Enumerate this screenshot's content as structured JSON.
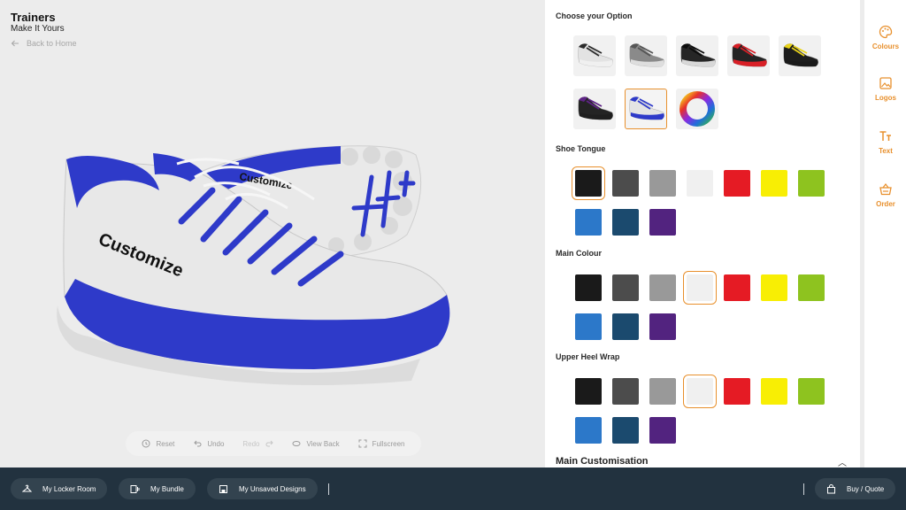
{
  "header": {
    "title": "Trainers",
    "subtitle": "Make It Yours",
    "back_label": "Back to Home"
  },
  "viewer": {
    "shoe_text": "Customize",
    "tongue_text": "Customize",
    "toolbar": {
      "reset": "Reset",
      "undo": "Undo",
      "redo": "Redo",
      "view_back": "View Back",
      "fullscreen": "Fullscreen"
    }
  },
  "panel": {
    "choose_title": "Choose your Option",
    "options": [
      {
        "name": "white-black",
        "upper": "#e3e3e3",
        "accent": "#2a2a2a",
        "sole": "#f0f0f0"
      },
      {
        "name": "grey",
        "upper": "#8a8a8a",
        "accent": "#555555",
        "sole": "#dedede"
      },
      {
        "name": "black",
        "upper": "#262626",
        "accent": "#0c0c0c",
        "sole": "#d8d8d8"
      },
      {
        "name": "black-red",
        "upper": "#242424",
        "accent": "#d81f26",
        "sole": "#d81f26"
      },
      {
        "name": "black-yellow",
        "upper": "#1d1d1d",
        "accent": "#e9d319",
        "sole": "#1a1a1a"
      },
      {
        "name": "black-purple",
        "upper": "#242424",
        "accent": "#5e2386",
        "sole": "#1f1f1f"
      },
      {
        "name": "white-blue",
        "upper": "#e4e4e4",
        "accent": "#2e3ac9",
        "sole": "#2e3ac9"
      }
    ],
    "selected_option": 6,
    "sections": [
      {
        "title": "Shoe Tongue",
        "selected": 0
      },
      {
        "title": "Main Colour",
        "selected": 3
      },
      {
        "title": "Upper Heel Wrap",
        "selected": 3
      }
    ],
    "swatch_colors": [
      "#1a1a1a",
      "#4c4c4c",
      "#999999",
      "#f0f0f0",
      "#e51b24",
      "#f8ee04",
      "#8ec31f",
      "#2c78c9",
      "#1b4a6e",
      "#52237f"
    ],
    "main_customisation": "Main Customisation"
  },
  "rail": {
    "items": [
      {
        "label": "Colours",
        "icon": "palette-icon"
      },
      {
        "label": "Logos",
        "icon": "image-icon"
      },
      {
        "label": "Text",
        "icon": "text-icon"
      },
      {
        "label": "Order",
        "icon": "basket-icon"
      }
    ]
  },
  "bottom": {
    "locker": "My Locker Room",
    "bundle": "My Bundle",
    "unsaved": "My Unsaved Designs",
    "buy": "Buy / Quote"
  },
  "colors": {
    "accent": "#e8902d",
    "bottom_bar": "#22323f",
    "shoe_blue": "#2e3ac9"
  }
}
